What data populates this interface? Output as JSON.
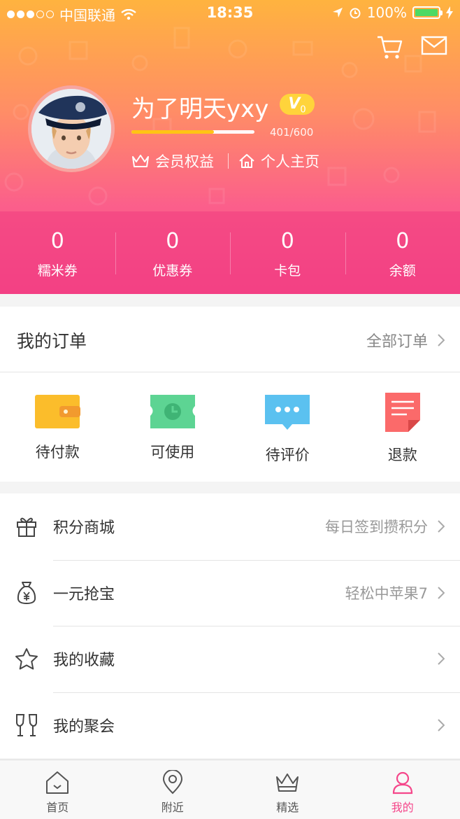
{
  "status_bar": {
    "carrier": "中国联通",
    "time": "18:35",
    "battery": "100%"
  },
  "profile": {
    "username": "为了明天yxy",
    "vip_badge": "V",
    "vip_level": "0",
    "exp_text": "401/600",
    "exp_fraction": 0.668,
    "benefits_label": "会员权益",
    "homepage_label": "个人主页"
  },
  "stats": [
    {
      "value": "0",
      "label": "糯米券"
    },
    {
      "value": "0",
      "label": "优惠券"
    },
    {
      "value": "0",
      "label": "卡包"
    },
    {
      "value": "0",
      "label": "余额"
    }
  ],
  "orders": {
    "title": "我的订单",
    "all_label": "全部订单",
    "items": [
      {
        "label": "待付款",
        "icon": "wallet-icon"
      },
      {
        "label": "可使用",
        "icon": "ticket-icon"
      },
      {
        "label": "待评价",
        "icon": "comment-icon"
      },
      {
        "label": "退款",
        "icon": "refund-icon"
      }
    ]
  },
  "menu": [
    {
      "label": "积分商城",
      "sub": "每日签到攒积分",
      "icon": "gift-icon"
    },
    {
      "label": "一元抢宝",
      "sub": "轻松中苹果7",
      "icon": "money-bag-icon"
    },
    {
      "label": "我的收藏",
      "sub": "",
      "icon": "star-icon"
    },
    {
      "label": "我的聚会",
      "sub": "",
      "icon": "glasses-icon"
    }
  ],
  "tabs": [
    {
      "label": "首页",
      "icon": "home-icon"
    },
    {
      "label": "附近",
      "icon": "location-icon"
    },
    {
      "label": "精选",
      "icon": "crown-icon"
    },
    {
      "label": "我的",
      "icon": "user-icon",
      "active": true
    }
  ],
  "colors": {
    "accent": "#f5468a",
    "gradient_top": "#ffb33f",
    "gradient_bottom": "#f5468a",
    "wallet": "#fbbd2b",
    "ticket": "#5dd493",
    "comment": "#5bc1f0",
    "refund": "#fb6a6a"
  }
}
